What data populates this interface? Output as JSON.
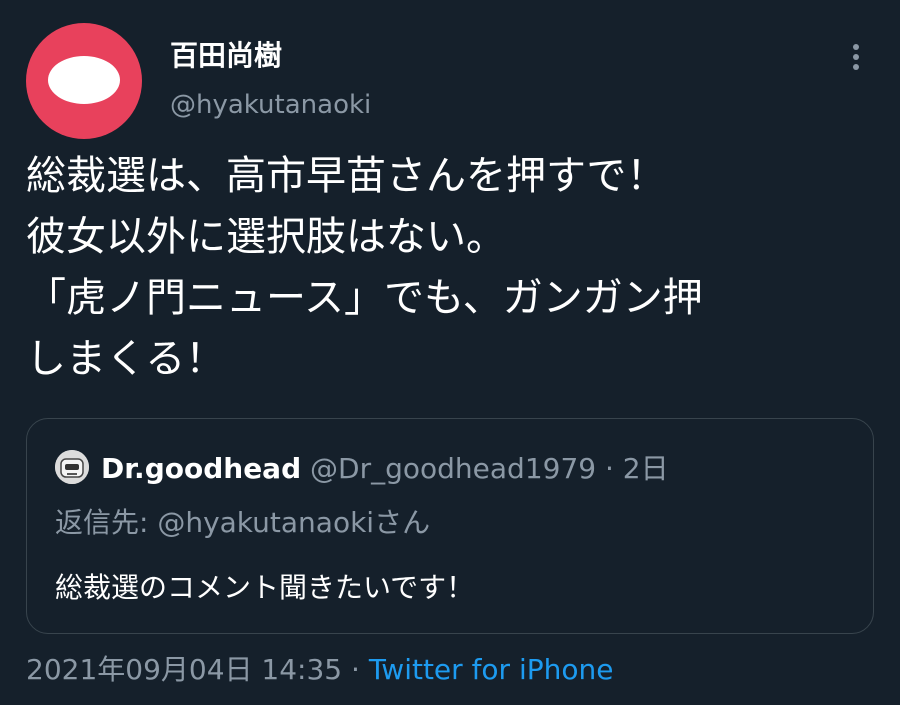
{
  "author": {
    "display_name": "百田尚樹",
    "handle": "@hyakutanaoki",
    "avatar_color": "#e8415c"
  },
  "tweet": {
    "lines": [
      "総裁選は、高市早苗さんを押すで！",
      "彼女以外に選択肢はない。",
      "「虎ノ門ニュース」でも、ガンガン押",
      "しまくる！"
    ]
  },
  "quoted_tweet": {
    "display_name": "Dr.goodhead",
    "handle": "@Dr_goodhead1979",
    "separator": "·",
    "time": "2日",
    "reply_to": "返信先: @hyakutanaokiさん",
    "text": "総裁選のコメント聞きたいです！"
  },
  "meta": {
    "timestamp": "2021年09月04日 14:35",
    "separator": "·",
    "source": "Twitter for iPhone",
    "source_color": "#1d9bf0"
  },
  "icons": {
    "more": "more-vertical-icon"
  },
  "colors": {
    "background": "#15202b",
    "secondary_text": "#8b98a5",
    "border": "#38444d"
  }
}
